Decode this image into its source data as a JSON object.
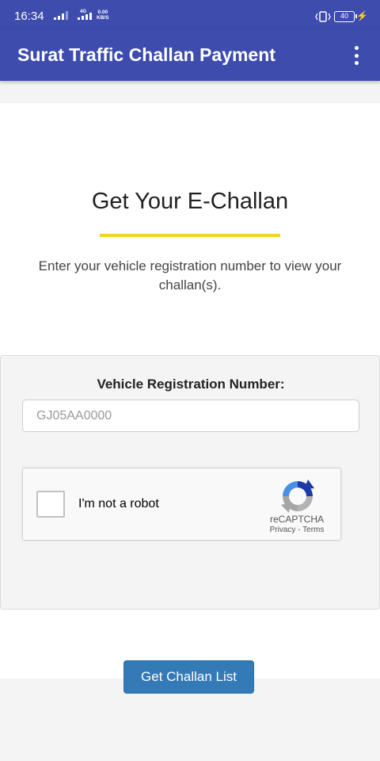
{
  "status_bar": {
    "time": "16:34",
    "network_type": "4G",
    "data_speed_value": "0.00",
    "data_speed_unit": "KB/S",
    "battery": "40"
  },
  "app_bar": {
    "title": "Surat Traffic Challan Payment",
    "menu_icon": "more-vert-icon"
  },
  "main": {
    "heading": "Get Your E-Challan",
    "description": "Enter your vehicle registration number to view your challan(s).",
    "accent_color": "#f1d32c"
  },
  "form": {
    "label": "Vehicle Registration Number:",
    "placeholder": "GJ05AA0000",
    "value": ""
  },
  "captcha": {
    "checkbox_label": "I'm not a robot",
    "checked": false,
    "brand": "reCAPTCHA",
    "privacy": "Privacy",
    "separator": " - ",
    "terms": "Terms"
  },
  "submit": {
    "label": "Get Challan List"
  },
  "colors": {
    "app_bar": "#3d4cad",
    "button": "#337ab7"
  }
}
